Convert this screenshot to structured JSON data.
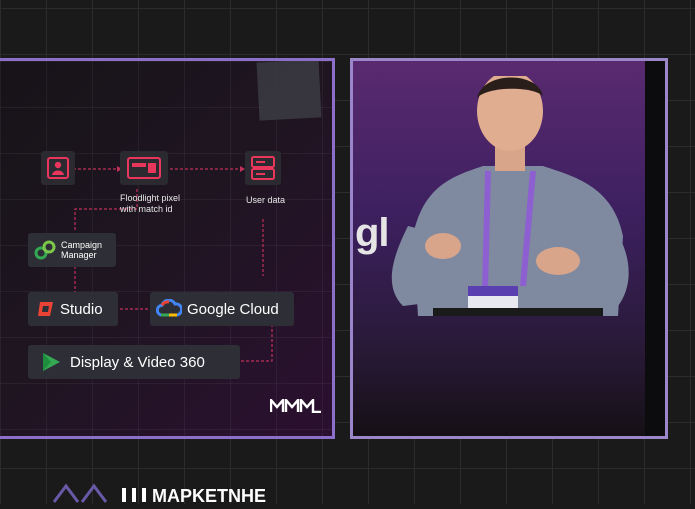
{
  "slide": {
    "nodes": {
      "user_icon": "user-icon",
      "floodlight_label": "Floodlight pixel\nwith match id",
      "user_data_label": "User data",
      "campaign_manager_label": "Campaign\nManager",
      "studio_label": "Studio",
      "google_cloud_label": "Google Cloud",
      "dv360_label": "Display & Video 360"
    },
    "colors": {
      "accent": "#e8365d",
      "connector": "#c0305a",
      "chip_bg": "#2e2e36",
      "frame_left": "#8b6fc8",
      "frame_right": "#9a86c9"
    }
  },
  "video": {
    "stage_sign_text": "gl"
  },
  "badge": {
    "text_brand": "MM"
  },
  "footer": {
    "logo_text": "MAPKETNHE"
  }
}
